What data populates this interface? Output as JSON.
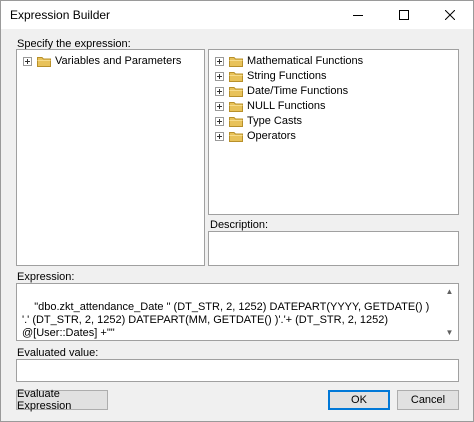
{
  "window": {
    "title": "Expression Builder"
  },
  "labels": {
    "specify": "Specify the expression:",
    "description": "Description:",
    "expression": "Expression:",
    "evaluated": "Evaluated value:"
  },
  "left_tree": [
    {
      "label": "Variables and Parameters",
      "icon": "folder-icon"
    }
  ],
  "right_tree": [
    {
      "label": "Mathematical Functions",
      "icon": "folder-icon"
    },
    {
      "label": "String Functions",
      "icon": "folder-icon"
    },
    {
      "label": "Date/Time Functions",
      "icon": "folder-icon"
    },
    {
      "label": "NULL Functions",
      "icon": "folder-icon"
    },
    {
      "label": "Type Casts",
      "icon": "folder-icon"
    },
    {
      "label": "Operators",
      "icon": "folder-icon"
    }
  ],
  "expression": {
    "value": "\"dbo.zkt_attendance_Date \" (DT_STR, 2, 1252) DATEPART(YYYY, GETDATE() ) '.' (DT_STR, 2, 1252) DATEPART(MM, GETDATE() )'.'+ (DT_STR, 2, 1252) @[User::Dates] +\"\""
  },
  "buttons": {
    "evaluate": "Evaluate Expression",
    "ok": "OK",
    "cancel": "Cancel"
  },
  "colors": {
    "folder": "#e8c25a",
    "default_border": "#0078d7"
  }
}
